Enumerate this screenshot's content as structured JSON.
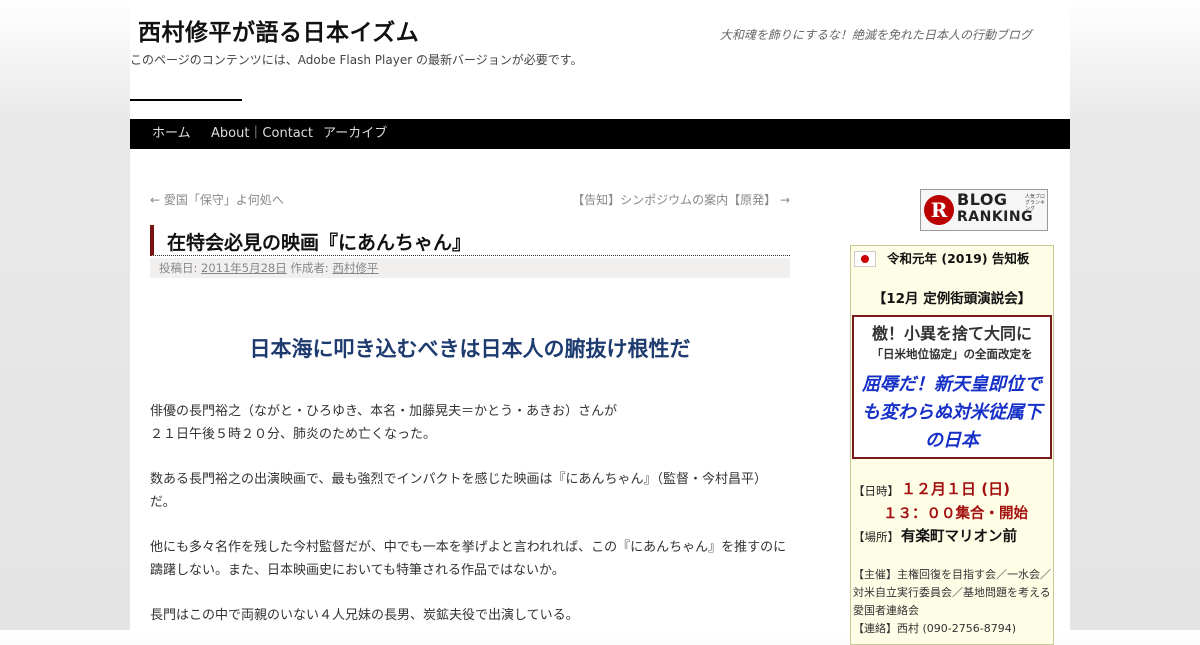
{
  "header": {
    "site_title": "西村修平が語る日本イズム",
    "site_description": "大和魂を飾りにするな！絶滅を免れた日本人の行動ブログ",
    "flash_notice": "このページのコンテンツには、Adobe Flash Player の最新バージョンが必要です。"
  },
  "nav": {
    "items": [
      {
        "label": "ホーム"
      },
      {
        "label": "About｜Contact"
      },
      {
        "label": "アーカイブ"
      }
    ]
  },
  "post_nav": {
    "prev": "← 愛国「保守」よ何処へ",
    "next": "【告知】シンポジウムの案内【原発】 →"
  },
  "post": {
    "title": "在特会必見の映画『にあんちゃん』",
    "meta_posted_label": "投稿日:",
    "meta_date": "2011年5月28日",
    "meta_author_label": "作成者:",
    "meta_author": "西村修平",
    "headline": "日本海に叩き込むべきは日本人の腑抜け根性だ",
    "paragraphs": [
      {
        "lines": [
          "俳優の長門裕之（ながと・ひろゆき、本名・加藤晃夫＝かとう・あきお）さんが",
          "２１日午後５時２０分、肺炎のため亡くなった。"
        ]
      },
      {
        "lines": [
          "数ある長門裕之の出演映画で、最も強烈でインパクトを感じた映画は『にあんちゃん』（監督・今村昌平）",
          "だ。"
        ]
      },
      {
        "lines": [
          "他にも多々名作を残した今村監督だが、中でも一本を挙げよと言われれば、この『にあんちゃん』を推すのに",
          "躊躇しない。また、日本映画史においても特筆される作品ではないか。"
        ]
      },
      {
        "lines": [
          "長門はこの中で両親のいない４人兄妹の長男、炭鉱夫役で出演している。"
        ]
      }
    ]
  },
  "sidebar": {
    "ranking_banner": {
      "blog": "BLOG",
      "ranking": "RANKING",
      "small": "人気ブログランキング",
      "icon": "r-logo-icon",
      "color": "#b00000"
    },
    "notice": {
      "title": "令和元年 (2019) 告知板",
      "event": "【12月 定例街頭演説会】",
      "box_line1": "檄！小異を捨て大同に",
      "box_line2": "「日米地位協定」の全面改定を",
      "box_line3": "屈辱だ！新天皇即位でも変わらぬ対米従属下の日本",
      "date_label": "【日時】",
      "date": "１２月１日 (日)",
      "time": "１３：００集合・開始",
      "place_label": "【場所】",
      "place": "有楽町マリオン前",
      "host": "【主催】主権回復を目指す会／一水会／対米自立実行委員会／基地問題を考える愛国者連絡会",
      "contact": "【連絡】西村 (090-2756-8794)"
    }
  },
  "colors": {
    "nav_bg": "#000000",
    "title_accent": "#7a1010",
    "headline": "#1e3b70",
    "box_text": "#1730c8",
    "date_red": "#a41010"
  }
}
